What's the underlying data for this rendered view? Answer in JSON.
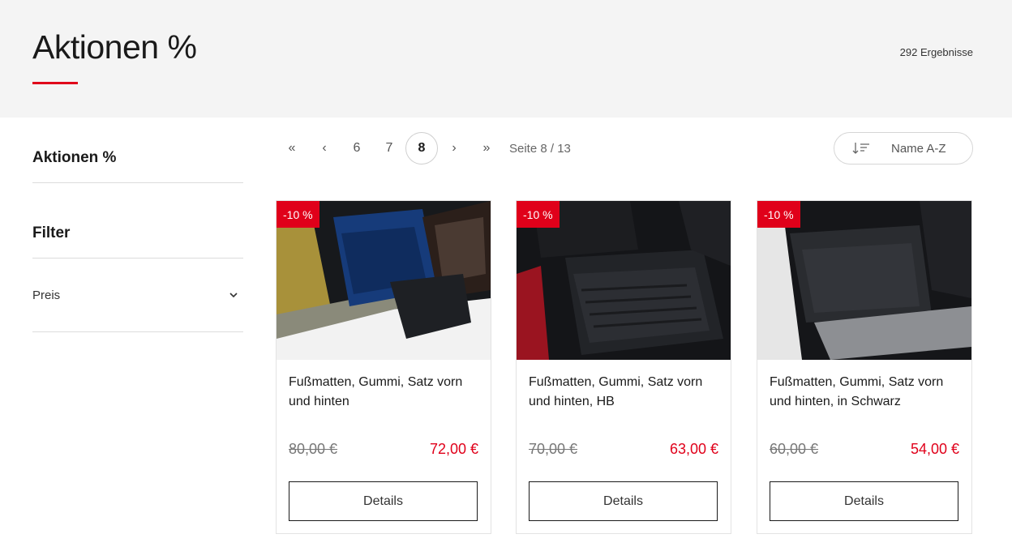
{
  "header": {
    "title": "Aktionen %",
    "result_count": "292 Ergebnisse"
  },
  "sidebar": {
    "category_heading": "Aktionen %",
    "filter_heading": "Filter",
    "filters": [
      {
        "label": "Preis"
      }
    ]
  },
  "pagination": {
    "first": "«",
    "prev": "‹",
    "pages": [
      "6",
      "7",
      "8"
    ],
    "current": "8",
    "next": "›",
    "last": "»",
    "page_label": "Seite 8 / 13"
  },
  "sort": {
    "label": "Name A-Z",
    "icon": "sort-descending-icon"
  },
  "products": [
    {
      "badge": "-10 %",
      "title": "Fußmatten, Gummi, Satz vorn und hinten",
      "old_price": "80,00 €",
      "new_price": "72,00 €",
      "button": "Details"
    },
    {
      "badge": "-10 %",
      "title": "Fußmatten, Gummi, Satz vorn und hinten, HB",
      "old_price": "70,00 €",
      "new_price": "63,00 €",
      "button": "Details"
    },
    {
      "badge": "-10 %",
      "title": "Fußmatten, Gummi, Satz vorn und hinten, in Schwarz",
      "old_price": "60,00 €",
      "new_price": "54,00 €",
      "button": "Details"
    }
  ],
  "colors": {
    "accent": "#e0001a",
    "header_bg": "#f4f4f4",
    "text": "#1a1a1a"
  }
}
